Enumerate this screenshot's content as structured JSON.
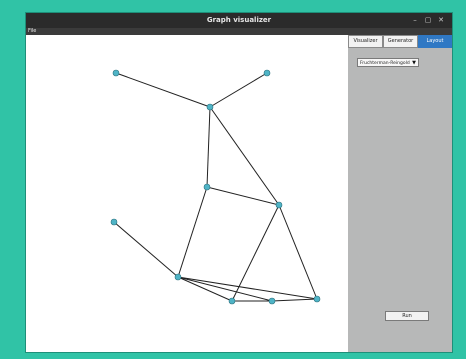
{
  "window": {
    "title": "Graph visualizer",
    "minimize": "–",
    "maximize": "▢",
    "close": "✕"
  },
  "menu": {
    "file": "File"
  },
  "tabs": [
    {
      "label": "Visualizer",
      "active": false
    },
    {
      "label": "Generator",
      "active": false
    },
    {
      "label": "Layout",
      "active": true
    }
  ],
  "layout": {
    "algorithm": "Fruchterman-Reingold",
    "run_label": "Run"
  },
  "colors": {
    "accent": "#2f78c4",
    "node": "#4fb4c6",
    "edge": "#222222",
    "desktop": "#30c3a6"
  },
  "graph": {
    "node_count": 11,
    "edges": [
      [
        0,
        1
      ],
      [
        2,
        1
      ],
      [
        1,
        3
      ],
      [
        1,
        4
      ],
      [
        3,
        4
      ],
      [
        3,
        6
      ],
      [
        4,
        6
      ],
      [
        4,
        7
      ],
      [
        4,
        8
      ],
      [
        5,
        6
      ],
      [
        6,
        7
      ],
      [
        6,
        8
      ],
      [
        7,
        8
      ]
    ]
  }
}
